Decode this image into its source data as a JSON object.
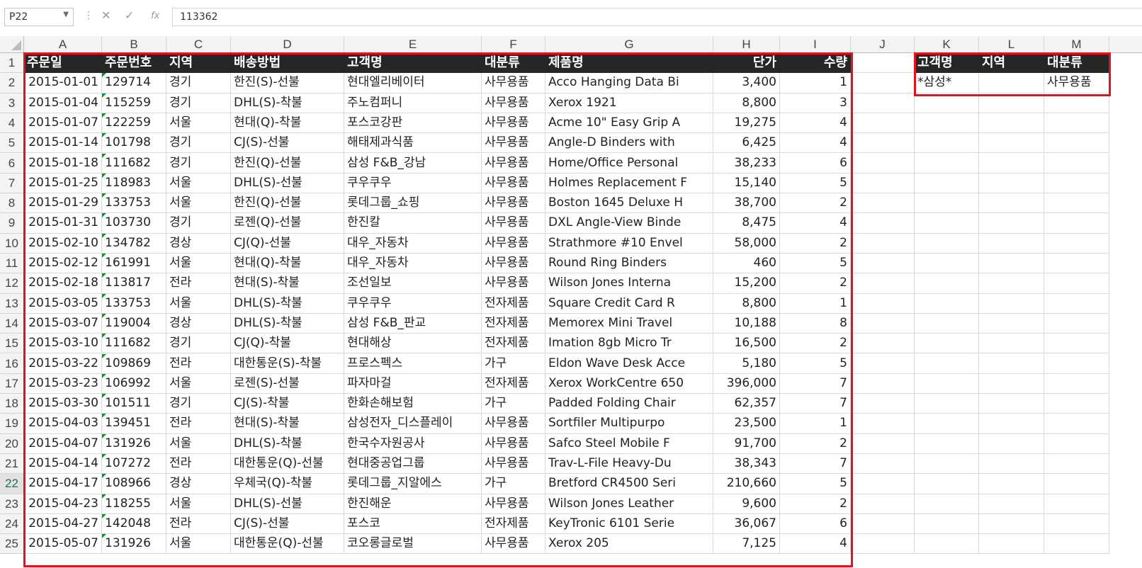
{
  "formula_bar": {
    "name_box": "P22",
    "cancel_glyph": "✕",
    "enter_glyph": "✓",
    "fx_glyph": "fx",
    "formula_value": "113362"
  },
  "columns": [
    "A",
    "B",
    "C",
    "D",
    "E",
    "F",
    "G",
    "H",
    "I",
    "J",
    "K",
    "L",
    "M"
  ],
  "row_numbers": [
    "1",
    "2",
    "3",
    "4",
    "5",
    "6",
    "7",
    "8",
    "9",
    "10",
    "11",
    "12",
    "13",
    "14",
    "15",
    "16",
    "17",
    "18",
    "19",
    "20",
    "21",
    "22",
    "23",
    "24",
    "25"
  ],
  "selected_row": "22",
  "headers": [
    "주문일",
    "주문번호",
    "지역",
    "배송방법",
    "고객명",
    "대분류",
    "제품명",
    "단가",
    "수량"
  ],
  "rows": [
    [
      "2015-01-01",
      "129714",
      "경기",
      "한진(S)-선불",
      "현대엘리베이터",
      "사무용품",
      "Acco Hanging Data Bi",
      "3,400",
      "1"
    ],
    [
      "2015-01-04",
      "115259",
      "경기",
      "DHL(S)-착불",
      "주노컴퍼니",
      "사무용품",
      "Xerox 1921",
      "8,800",
      "3"
    ],
    [
      "2015-01-07",
      "122259",
      "서울",
      "현대(Q)-착불",
      "포스코강판",
      "사무용품",
      "Acme 10\" Easy Grip A",
      "19,275",
      "4"
    ],
    [
      "2015-01-14",
      "101798",
      "경기",
      "CJ(S)-선불",
      "해태제과식품",
      "사무용품",
      "Angle-D Binders with",
      "6,425",
      "4"
    ],
    [
      "2015-01-18",
      "111682",
      "경기",
      "한진(Q)-선불",
      "삼성 F&B_강남",
      "사무용품",
      "Home/Office Personal",
      "38,233",
      "6"
    ],
    [
      "2015-01-25",
      "118983",
      "서울",
      "DHL(S)-선불",
      "쿠우쿠우",
      "사무용품",
      "Holmes Replacement F",
      "15,140",
      "5"
    ],
    [
      "2015-01-29",
      "133753",
      "서울",
      "한진(Q)-선불",
      "롯데그룹_쇼핑",
      "사무용품",
      "Boston 1645 Deluxe H",
      "38,700",
      "2"
    ],
    [
      "2015-01-31",
      "103730",
      "경기",
      "로젠(Q)-선불",
      "한진칼",
      "사무용품",
      "DXL Angle-View Binde",
      "8,475",
      "4"
    ],
    [
      "2015-02-10",
      "134782",
      "경상",
      "CJ(Q)-선불",
      "대우_자동차",
      "사무용품",
      "Strathmore #10 Envel",
      "58,000",
      "2"
    ],
    [
      "2015-02-12",
      "161991",
      "서울",
      "현대(Q)-착불",
      "대우_자동차",
      "사무용품",
      "Round Ring Binders",
      "460",
      "5"
    ],
    [
      "2015-02-18",
      "113817",
      "전라",
      "현대(S)-착불",
      "조선일보",
      "사무용품",
      "Wilson Jones Interna",
      "15,200",
      "2"
    ],
    [
      "2015-03-05",
      "133753",
      "서울",
      "DHL(S)-착불",
      "쿠우쿠우",
      "전자제품",
      "Square Credit Card R",
      "8,800",
      "1"
    ],
    [
      "2015-03-07",
      "119004",
      "경상",
      "DHL(S)-착불",
      "삼성 F&B_판교",
      "전자제품",
      "Memorex Mini Travel",
      "10,188",
      "8"
    ],
    [
      "2015-03-10",
      "111682",
      "경기",
      "CJ(Q)-착불",
      "현대해상",
      "전자제품",
      "Imation 8gb Micro Tr",
      "16,500",
      "2"
    ],
    [
      "2015-03-22",
      "109869",
      "전라",
      "대한통운(S)-착불",
      "프로스펙스",
      "가구",
      "Eldon Wave Desk Acce",
      "5,180",
      "5"
    ],
    [
      "2015-03-23",
      "106992",
      "서울",
      "로젠(S)-선불",
      "파자마걸",
      "전자제품",
      "Xerox WorkCentre 650",
      "396,000",
      "7"
    ],
    [
      "2015-03-30",
      "101511",
      "경기",
      "CJ(S)-착불",
      "한화손해보험",
      "가구",
      "Padded Folding Chair",
      "62,357",
      "7"
    ],
    [
      "2015-04-03",
      "139451",
      "전라",
      "현대(S)-착불",
      "삼성전자_디스플레이",
      "사무용품",
      "Sortfiler Multipurpo",
      "23,500",
      "1"
    ],
    [
      "2015-04-07",
      "131926",
      "서울",
      "DHL(S)-착불",
      "한국수자원공사",
      "사무용품",
      "Safco Steel Mobile F",
      "91,700",
      "2"
    ],
    [
      "2015-04-14",
      "107272",
      "전라",
      "대한통운(Q)-선불",
      "현대중공업그룹",
      "사무용품",
      "Trav-L-File Heavy-Du",
      "38,343",
      "7"
    ],
    [
      "2015-04-17",
      "108966",
      "경상",
      "우체국(Q)-착불",
      "롯데그룹_지알에스",
      "가구",
      "Bretford CR4500 Seri",
      "210,660",
      "5"
    ],
    [
      "2015-04-23",
      "118255",
      "서울",
      "DHL(S)-선불",
      "한진해운",
      "사무용품",
      "Wilson Jones Leather",
      "9,600",
      "2"
    ],
    [
      "2015-04-27",
      "142048",
      "전라",
      "CJ(S)-선불",
      "포스코",
      "전자제품",
      "KeyTronic 6101 Serie",
      "36,067",
      "6"
    ],
    [
      "2015-05-07",
      "131926",
      "서울",
      "대한통운(Q)-선불",
      "코오롱글로벌",
      "사무용품",
      "Xerox 205",
      "7,125",
      "4"
    ]
  ],
  "criteria": {
    "headers": [
      "고객명",
      "지역",
      "대분류"
    ],
    "values": [
      "*삼성*",
      "",
      "사무용품"
    ]
  },
  "colors": {
    "header_bg": "#262626",
    "highlight_border": "#e0141e",
    "row_selected": "#217346"
  }
}
